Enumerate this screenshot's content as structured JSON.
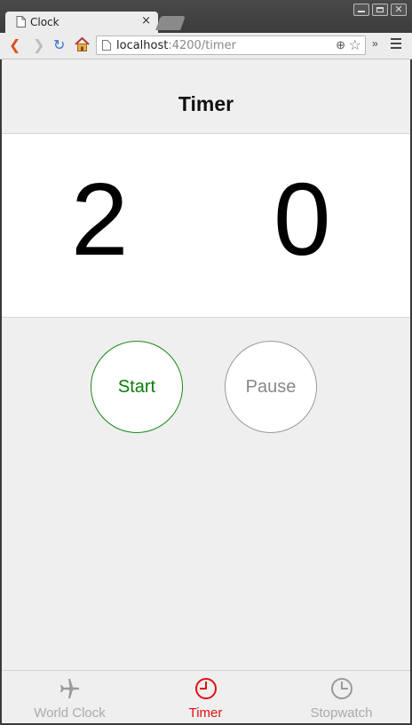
{
  "browser": {
    "tab_title": "Clock",
    "tab_close": "×",
    "url_host": "localhost",
    "url_path": ":4200/timer"
  },
  "header": {
    "title": "Timer"
  },
  "timer": {
    "left_digit": "2",
    "right_digit": "0"
  },
  "controls": {
    "start_label": "Start",
    "pause_label": "Pause"
  },
  "tabs": [
    {
      "label": "World Clock",
      "icon": "airplane-icon",
      "active": false
    },
    {
      "label": "Timer",
      "icon": "timer-icon",
      "active": true
    },
    {
      "label": "Stopwatch",
      "icon": "stopwatch-icon",
      "active": false
    }
  ],
  "colors": {
    "active_tab": "#e01010",
    "start": "#0a7d0a",
    "pause": "#888888"
  }
}
